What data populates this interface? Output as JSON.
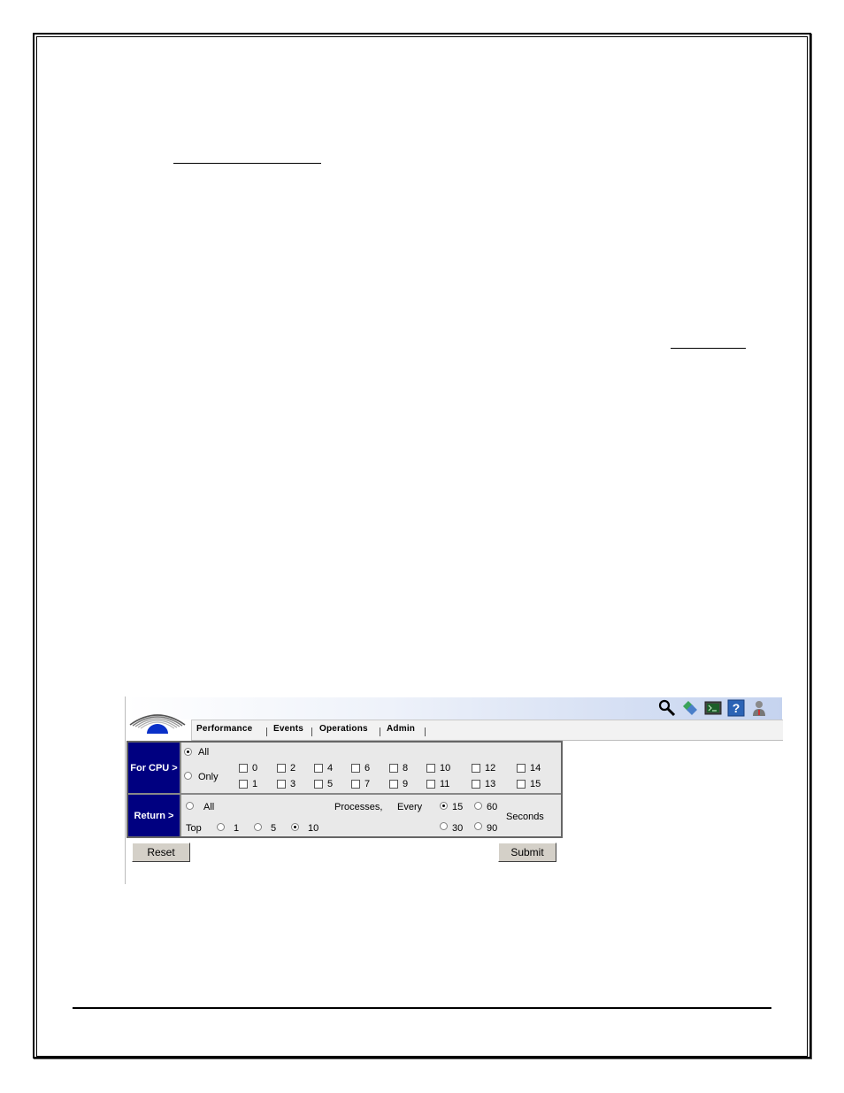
{
  "app": {
    "nav": [
      "Performance",
      "Events",
      "Operations",
      "Admin"
    ],
    "toolbar_icons": [
      "search-icon",
      "diamond-icon",
      "terminal-icon",
      "help-icon",
      "user-icon"
    ],
    "form": {
      "cpu_label": "For CPU >",
      "cpu_all": "All",
      "cpu_only": "Only",
      "cpu_selected": "All",
      "cpus": [
        "0",
        "1",
        "2",
        "3",
        "4",
        "5",
        "6",
        "7",
        "8",
        "9",
        "10",
        "11",
        "12",
        "13",
        "14",
        "15"
      ],
      "return_label": "Return >",
      "return_all": "All",
      "top_label": "Top",
      "top_options": [
        "1",
        "5",
        "10"
      ],
      "top_selected": "10",
      "processes_label": "Processes,",
      "every_label": "Every",
      "interval_options": [
        "15",
        "60",
        "30",
        "90"
      ],
      "interval_selected": "15",
      "seconds_label": "Seconds",
      "reset": "Reset",
      "submit": "Submit"
    }
  }
}
